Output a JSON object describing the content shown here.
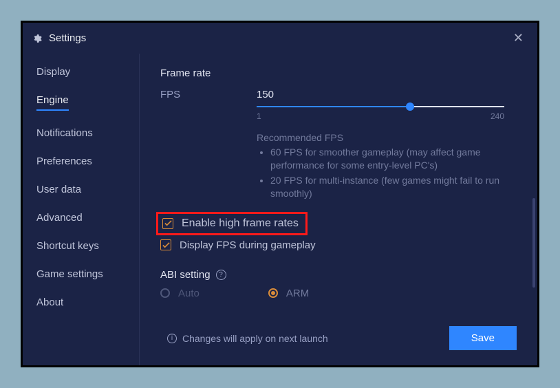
{
  "window": {
    "title": "Settings"
  },
  "sidebar": {
    "items": [
      {
        "label": "Display"
      },
      {
        "label": "Engine"
      },
      {
        "label": "Notifications"
      },
      {
        "label": "Preferences"
      },
      {
        "label": "User data"
      },
      {
        "label": "Advanced"
      },
      {
        "label": "Shortcut keys"
      },
      {
        "label": "Game settings"
      },
      {
        "label": "About"
      }
    ],
    "active_index": 1
  },
  "frame_rate": {
    "section_title": "Frame rate",
    "fps_label": "FPS",
    "fps_value": "150",
    "slider_min": "1",
    "slider_max": "240",
    "slider_percent": 62,
    "recommended_title": "Recommended FPS",
    "recommended": [
      "60 FPS for smoother gameplay (may affect game performance for some entry-level PC's)",
      "20 FPS for multi-instance (few games might fail to run smoothly)"
    ],
    "chk_high_frame": "Enable high frame rates",
    "chk_display_fps": "Display FPS during gameplay",
    "chk_high_checked": true,
    "chk_display_checked": true
  },
  "abi": {
    "title": "ABI setting",
    "options": [
      {
        "label": "Auto",
        "selected": false
      },
      {
        "label": "ARM",
        "selected": true
      }
    ]
  },
  "footer": {
    "text": "Changes will apply on next launch",
    "save": "Save"
  }
}
